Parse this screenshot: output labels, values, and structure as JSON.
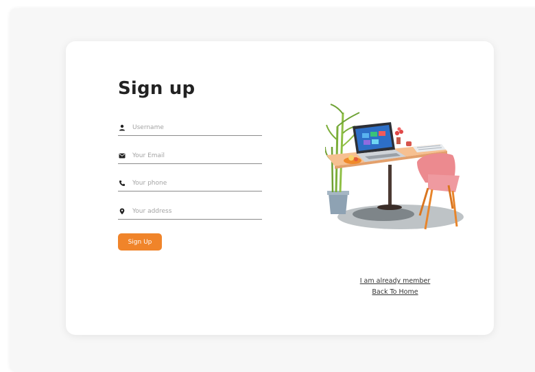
{
  "title": "Sign up",
  "fields": {
    "username": {
      "placeholder": "Username",
      "icon": "user-icon"
    },
    "email": {
      "placeholder": "Your Email",
      "icon": "envelope-icon"
    },
    "phone": {
      "placeholder": "Your phone",
      "icon": "phone-icon"
    },
    "address": {
      "placeholder": "Your address",
      "icon": "location-pin-icon"
    }
  },
  "submit_label": "Sign Up",
  "links": {
    "already_member": "I am already member",
    "back_home": "Back To Home"
  },
  "colors": {
    "accent": "#f0842a",
    "title": "#222222",
    "card_bg": "#ffffff",
    "page_bg": "#f7f7f7"
  }
}
